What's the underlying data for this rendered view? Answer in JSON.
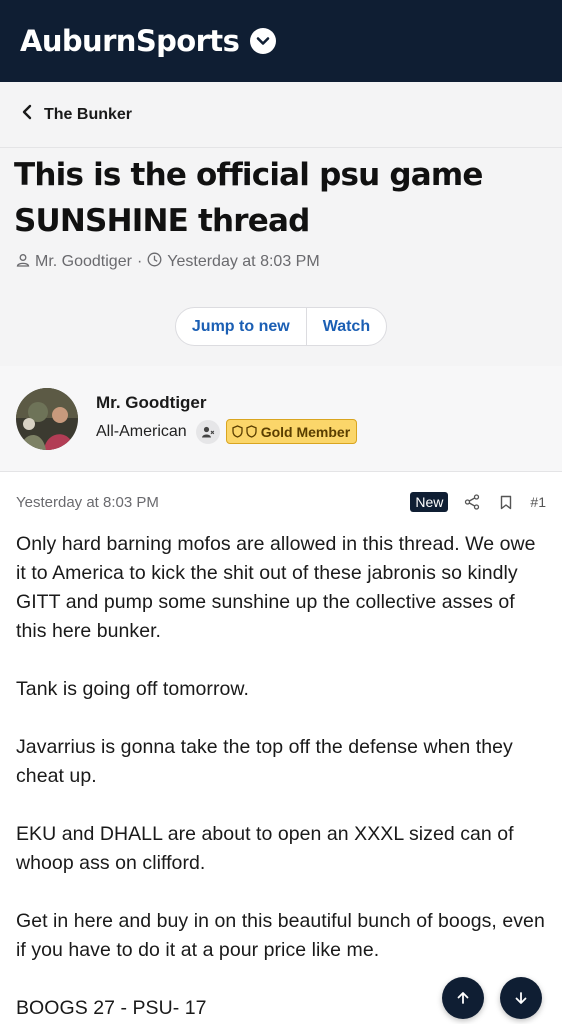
{
  "brand": {
    "name": "AuburnSports",
    "icon": "chevron-down-icon"
  },
  "breadcrumb": {
    "label": "The Bunker",
    "icon": "chevron-left-icon"
  },
  "thread": {
    "title_line1": "This is the official psu game",
    "title_line2": "SUNSHINE thread",
    "author": "Mr. Goodtiger",
    "timestamp": "Yesterday at 8:03 PM",
    "separator": "·"
  },
  "actions": {
    "jump_to_new": "Jump to new",
    "watch": "Watch"
  },
  "post_author": {
    "name": "Mr. Goodtiger",
    "rank": "All-American",
    "badge": "Gold Member"
  },
  "post": {
    "time": "Yesterday at 8:03 PM",
    "new_label": "New",
    "number": "#1",
    "paragraphs": [
      "Only hard barning mofos are allowed in this thread. We owe it to America to kick the shit out of these jabronis so kindly GITT and pump some sunshine up the collective asses of this here bunker.",
      "Tank is going off tomorrow.",
      "Javarrius is gonna take the top off the defense when they cheat up.",
      "EKU and DHALL are about to open an XXXL sized can of whoop ass on clifford.",
      "Get in here and buy in on this beautiful bunch of boogs, even if you have to do it at a pour price like me.",
      "BOOGS 27 - PSU- 17"
    ]
  },
  "colors": {
    "header_bg": "#0f1e33",
    "accent_blue": "#1b5fb4",
    "gold": "#fbd66a"
  }
}
